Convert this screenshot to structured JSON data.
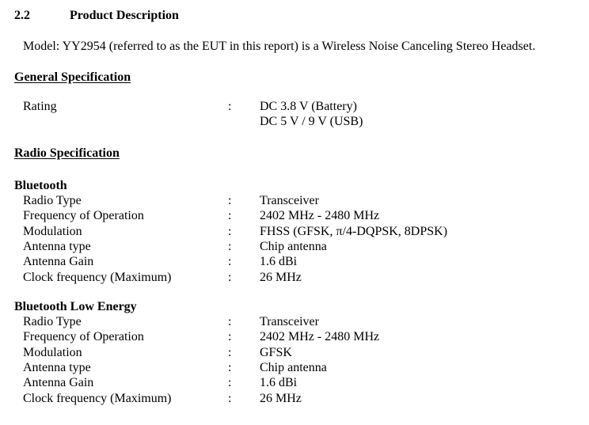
{
  "section": {
    "number": "2.2",
    "title": "Product Description",
    "intro": "Model: YY2954 (referred to as the EUT in this report) is a Wireless Noise Canceling Stereo Headset."
  },
  "general": {
    "heading": "General Specification",
    "rating_label": "Rating",
    "colon": ":",
    "rating_values": [
      "DC 3.8 V (Battery)",
      "DC 5 V / 9 V (USB)"
    ]
  },
  "radio": {
    "heading": "Radio Specification",
    "groups": [
      {
        "title": "Bluetooth",
        "rows": [
          {
            "label": "Radio Type",
            "value": "Transceiver"
          },
          {
            "label": "Frequency of Operation",
            "value": "2402 MHz - 2480 MHz"
          },
          {
            "label": "Modulation",
            "value": "FHSS (GFSK, π/4-DQPSK, 8DPSK)"
          },
          {
            "label": "Antenna type",
            "value": "Chip antenna"
          },
          {
            "label": "Antenna Gain",
            "value": "1.6 dBi"
          },
          {
            "label": "Clock frequency (Maximum)",
            "value": "26 MHz"
          }
        ]
      },
      {
        "title": "Bluetooth Low Energy",
        "rows": [
          {
            "label": "Radio Type",
            "value": "Transceiver"
          },
          {
            "label": "Frequency of Operation",
            "value": "2402 MHz - 2480 MHz"
          },
          {
            "label": "Modulation",
            "value": "GFSK"
          },
          {
            "label": "Antenna type",
            "value": "Chip antenna"
          },
          {
            "label": "Antenna Gain",
            "value": "1.6 dBi"
          },
          {
            "label": "Clock frequency (Maximum)",
            "value": "26 MHz"
          }
        ]
      }
    ]
  }
}
